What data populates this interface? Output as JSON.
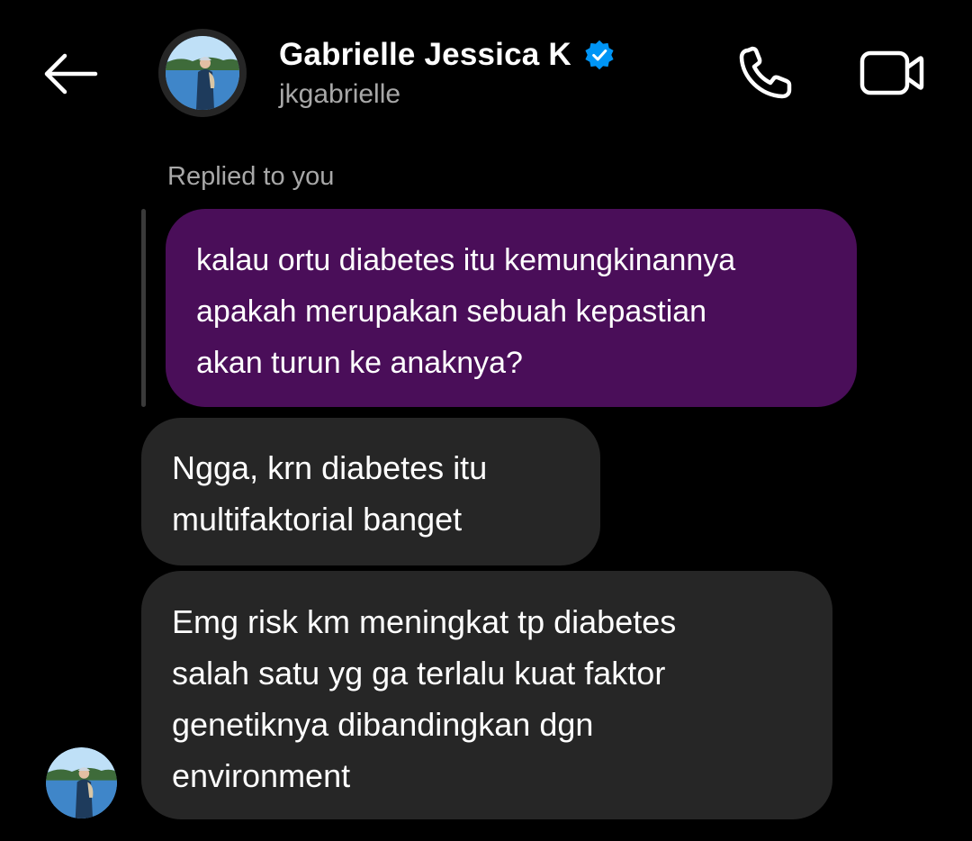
{
  "header": {
    "back_icon": "arrow-left-icon",
    "display_name": "Gabrielle Jessica K",
    "verified_icon": "verified-badge-icon",
    "username": "jkgabrielle",
    "call_icon": "phone-icon",
    "video_icon": "video-camera-icon"
  },
  "thread": {
    "reply_context_label": "Replied to you",
    "quoted_message": "kalau ortu diabetes itu kemungkinannya\napakah merupakan sebuah kepastian\nakan turun ke anaknya?",
    "messages": [
      {
        "text": "Ngga, krn diabetes itu\nmultifaktorial banget"
      },
      {
        "text": "Emg risk km meningkat tp diabetes\nsalah satu yg ga terlalu kuat faktor\ngenetiknya dibandingkan dgn\nenvironment"
      }
    ]
  },
  "colors": {
    "background": "#000000",
    "quoted_bubble": "#4a0e59",
    "received_bubble": "#262626",
    "secondary_text": "#a8a8a8",
    "verified_blue": "#0095f6"
  }
}
